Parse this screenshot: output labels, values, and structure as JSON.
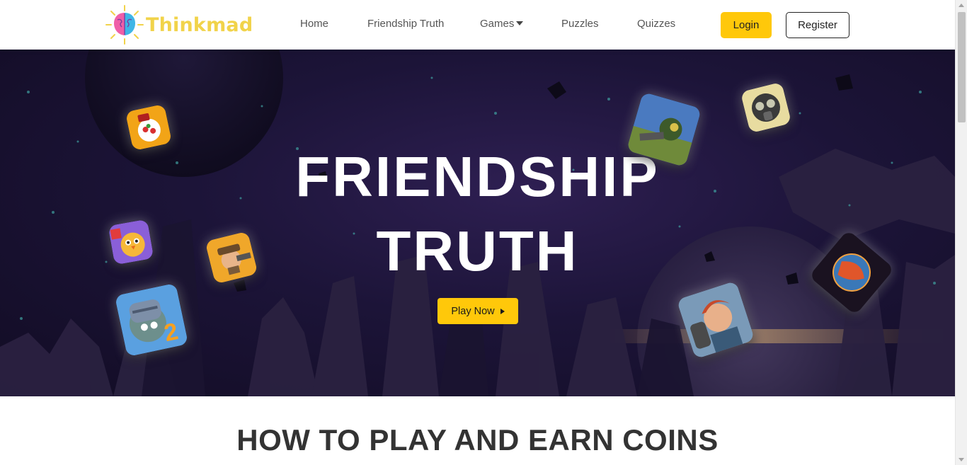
{
  "brand": {
    "name": "Thinkmad"
  },
  "nav": {
    "items": [
      {
        "label": "Home"
      },
      {
        "label": "Friendship Truth"
      },
      {
        "label": "Games"
      },
      {
        "label": "Puzzles"
      },
      {
        "label": "Quizzes"
      }
    ],
    "login_label": "Login",
    "register_label": "Register"
  },
  "hero": {
    "title_line1": "FRIENDSHIP",
    "title_line2": "TRUTH",
    "play_label": "Play Now"
  },
  "section": {
    "title": "HOW TO PLAY AND EARN COINS"
  },
  "colors": {
    "accent": "#ffc80a",
    "logo_text": "#f1d34a",
    "hero_bg": "#1c1438"
  }
}
